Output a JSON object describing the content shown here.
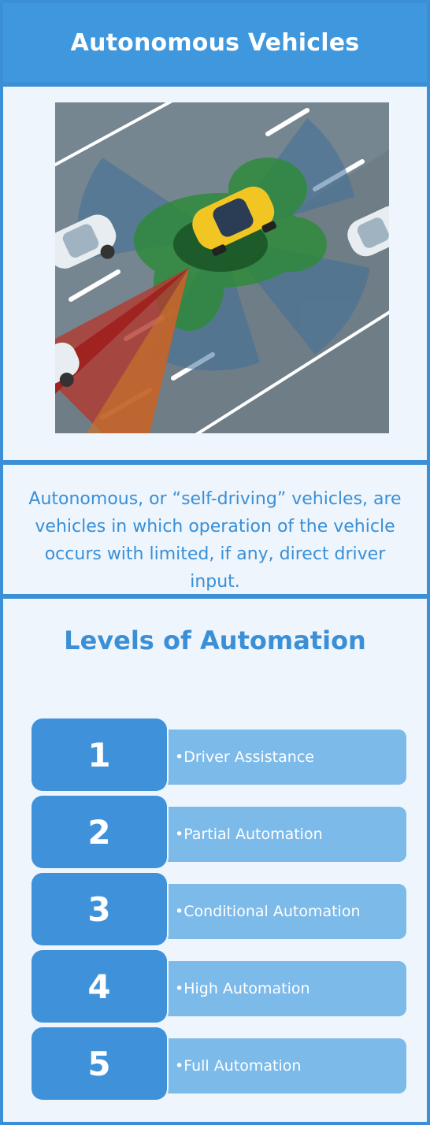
{
  "header": {
    "title": "Autonomous Vehicles"
  },
  "image": {
    "icon": "self-driving-car-sensor-illustration"
  },
  "description": "Autonomous, or “self-driving” vehicles, are vehicles in which operation of the vehicle occurs with limited, if any, direct driver input.",
  "levels": {
    "title": "Levels of Automation",
    "items": [
      {
        "number": "1",
        "label": "•Driver Assistance"
      },
      {
        "number": "2",
        "label": "•Partial Automation"
      },
      {
        "number": "3",
        "label": "•Conditional Automation"
      },
      {
        "number": "4",
        "label": "•High Automation"
      },
      {
        "number": "5",
        "label": "•Full Automation"
      }
    ]
  },
  "colors": {
    "primary": "#3a8fd6",
    "bar": "#7cbaea",
    "panel": "#eef5fd"
  }
}
